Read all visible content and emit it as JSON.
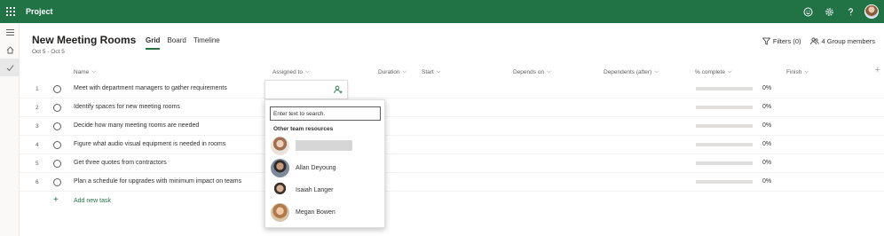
{
  "app": {
    "name": "Project",
    "icons": [
      "app-launcher-icon",
      "smiley-icon",
      "settings-icon",
      "help-icon",
      "account-avatar"
    ]
  },
  "project": {
    "title": "New Meeting Rooms",
    "dates": "Oct 5 - Oct 5"
  },
  "tabs": [
    {
      "label": "Grid",
      "active": true
    },
    {
      "label": "Board",
      "active": false
    },
    {
      "label": "Timeline",
      "active": false
    }
  ],
  "header_actions": {
    "filters": "Filters (0)",
    "group": "4 Group members"
  },
  "columns": {
    "name": "Name",
    "assigned": "Assigned to",
    "duration": "Duration",
    "start": "Start",
    "depends": "Depends on",
    "dependents": "Dependents (after)",
    "complete": "% complete",
    "finish": "Finish"
  },
  "tasks": [
    {
      "num": "1",
      "name": "Meet with department managers to gather requirements",
      "complete": "0%"
    },
    {
      "num": "2",
      "name": "Identify spaces for new meeting rooms",
      "complete": "0%"
    },
    {
      "num": "3",
      "name": "Decide how many meeting rooms are needed",
      "complete": "0%"
    },
    {
      "num": "4",
      "name": "Figure what audio visual equipment is needed in rooms",
      "complete": "0%"
    },
    {
      "num": "5",
      "name": "Get three quotes from contractors",
      "complete": "0%"
    },
    {
      "num": "6",
      "name": "Plan a schedule for upgrades with minimum impact on teams",
      "complete": "0%"
    }
  ],
  "new_task": "Add new task",
  "assign_dropdown": {
    "search_placeholder": "Enter text to search.",
    "section_label": "Other team resources",
    "people": [
      {
        "name": "",
        "redacted": true
      },
      {
        "name": "Allan Deyoung"
      },
      {
        "name": "Isaiah Langer"
      },
      {
        "name": "Megan Bowen"
      }
    ]
  },
  "colors": {
    "brand": "#217346",
    "bar_bg": "#e1dfdd"
  }
}
